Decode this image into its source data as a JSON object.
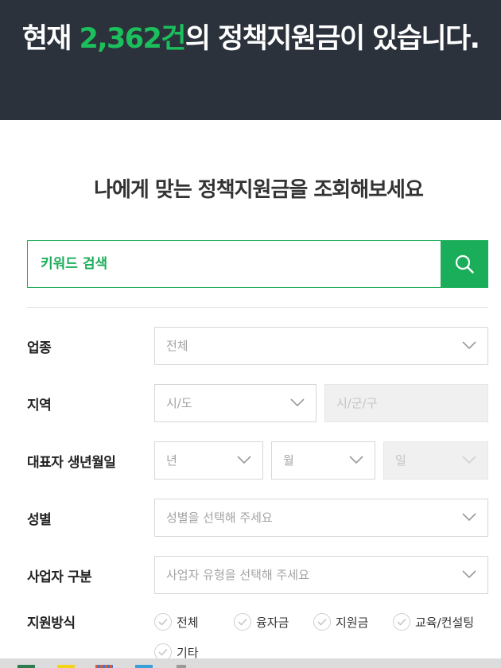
{
  "hero": {
    "prefix": "현재 ",
    "count": "2,362건",
    "suffix": "의 정책지원금이 있습니다."
  },
  "subtitle": "나에게 맞는 정책지원금을 조회해보세요",
  "search": {
    "placeholder": "키워드 검색",
    "icon": "search-icon"
  },
  "filters": {
    "industry": {
      "label": "업종",
      "value": "전체"
    },
    "region": {
      "label": "지역",
      "city": "시/도",
      "district": "시/군/구"
    },
    "birth": {
      "label": "대표자 생년월일",
      "year": "년",
      "month": "월",
      "day": "일"
    },
    "gender": {
      "label": "성별",
      "placeholder": "성별을 선택해 주세요"
    },
    "business": {
      "label": "사업자 구분",
      "placeholder": "사업자 유형을 선택해 주세요"
    },
    "method": {
      "label": "지원방식",
      "options": [
        "전체",
        "융자금",
        "지원금",
        "교육/컨설팅",
        "기타"
      ]
    }
  },
  "colors": {
    "accent": "#1bae5a",
    "hero_bg": "#2b323b",
    "count": "#1bbf5c"
  }
}
